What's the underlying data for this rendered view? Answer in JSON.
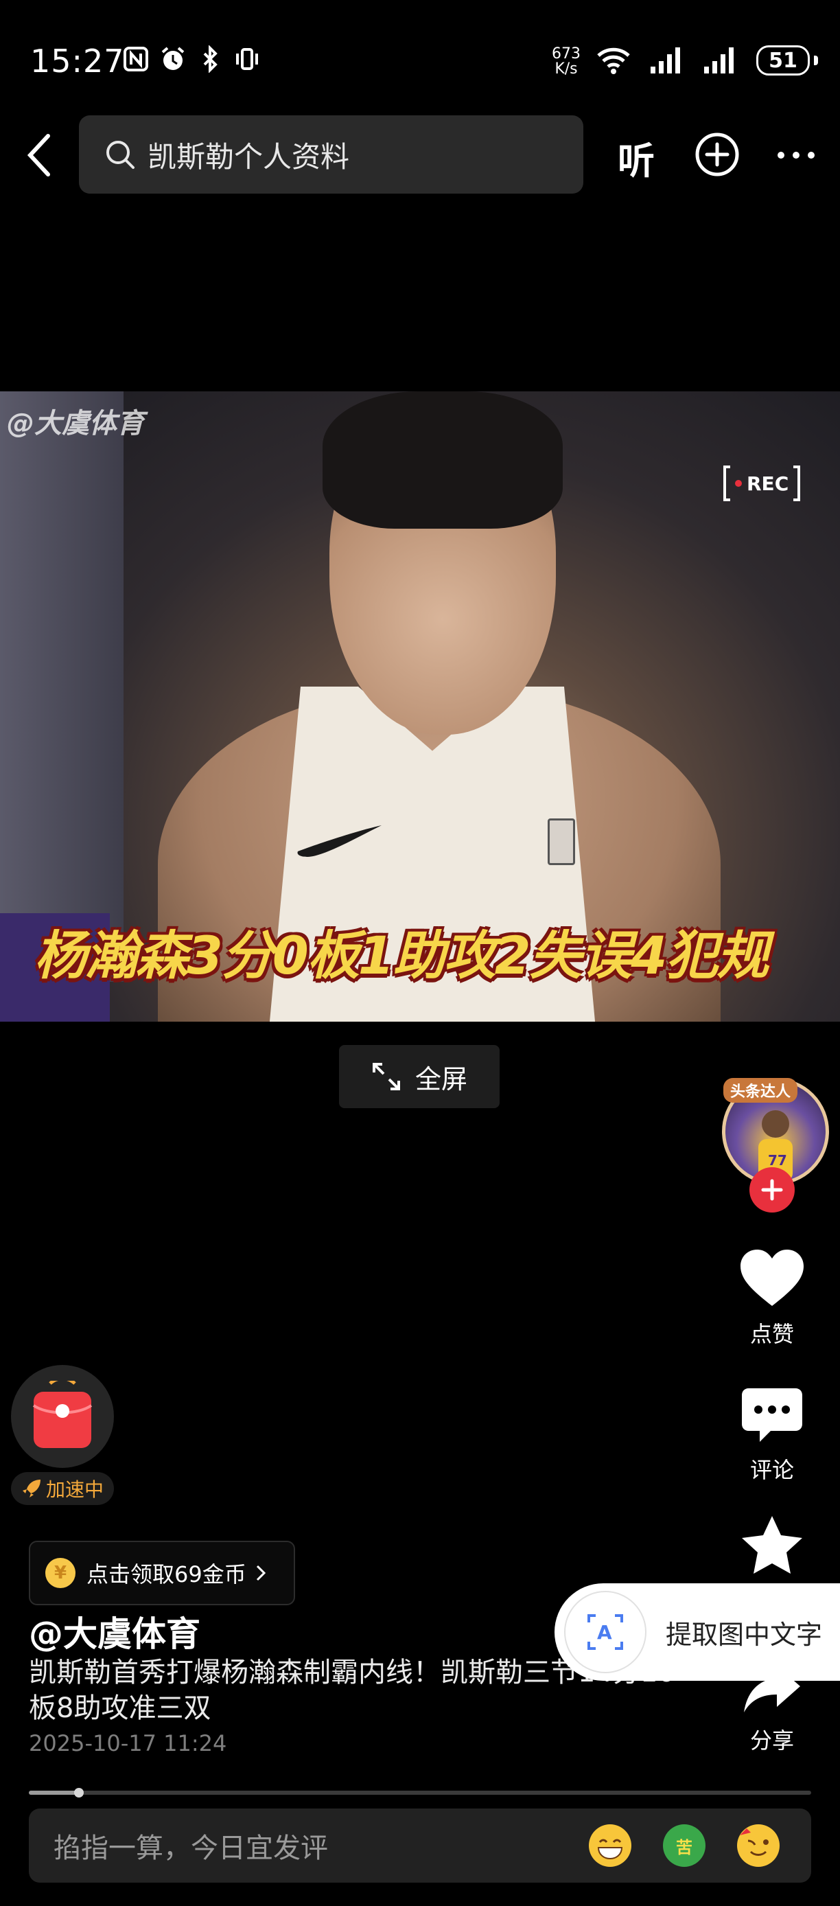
{
  "status_bar": {
    "time": "15:27",
    "net_speed_value": "673",
    "net_speed_unit": "K/s",
    "battery": "51"
  },
  "top_nav": {
    "search_text": "凯斯勒个人资料",
    "listen_label": "听"
  },
  "video": {
    "watermark": "@大虞体育",
    "rec_label": "REC",
    "caption": "杨瀚森3分0板1助攻2失误4犯规",
    "fullscreen_label": "全屏"
  },
  "right_rail": {
    "avatar_badge": "头条达人",
    "like_label": "点赞",
    "comment_label": "评论",
    "share_label": "分享"
  },
  "red_packet": {
    "status": "加速中"
  },
  "coins": {
    "label": "点击领取69金币",
    "coin_symbol": "¥"
  },
  "post": {
    "author": "@大虞体育",
    "description": "凯斯勒首秀打爆杨瀚森制霸内线！凯斯勒三节14分10板8助攻准三双",
    "date": "2025-10-17 11:24"
  },
  "ocr": {
    "label": "提取图中文字"
  },
  "progress": {
    "fraction": 0.064
  },
  "comment_bar": {
    "placeholder": "掐指一算，今日宜发评",
    "emoji_2_text": "苦"
  },
  "colors": {
    "accent_red": "#e8303d",
    "caption_yellow": "#f7d64a",
    "packet_orange": "#f4a93b"
  }
}
